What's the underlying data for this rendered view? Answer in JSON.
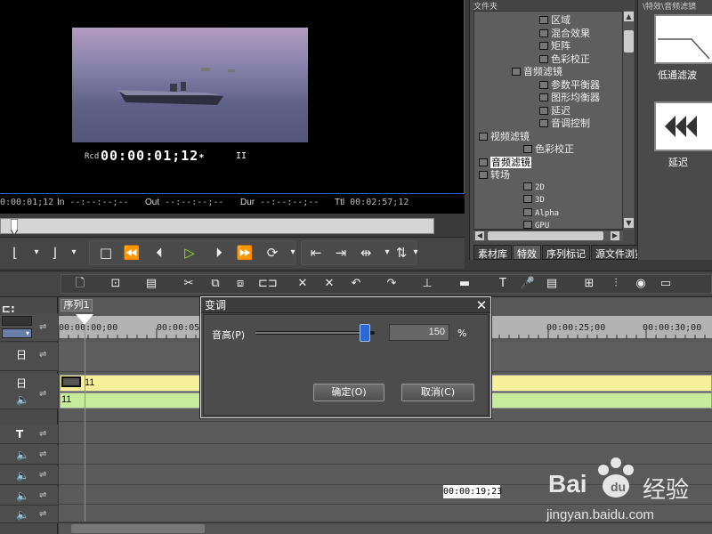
{
  "preview": {
    "rec_label": "Rcd",
    "timecode": "00:00:01;12",
    "tc_suffix": "*",
    "pause_symbol": "II",
    "current": "0:00:01;12",
    "in_label": "In",
    "in_value": "--:--:--;--",
    "out_label": "Out",
    "out_value": "--:--:--;--",
    "dur_label": "Dur",
    "dur_value": "--:--:--;--",
    "ttl_label": "Ttl",
    "ttl_value": "00:02:57;12"
  },
  "folder_panel": {
    "title": "文件夹",
    "tree": [
      {
        "label": "区域",
        "level": 3
      },
      {
        "label": "混合效果",
        "level": 3
      },
      {
        "label": "矩阵",
        "level": 3
      },
      {
        "label": "色彩校正",
        "level": 3
      },
      {
        "label": "音频滤镜",
        "level": 2
      },
      {
        "label": "参数平衡器",
        "level": 3
      },
      {
        "label": "图形均衡器",
        "level": 3
      },
      {
        "label": "延迟",
        "level": 3
      },
      {
        "label": "音调控制",
        "level": 3
      },
      {
        "label": "视频滤镜",
        "level": 1
      },
      {
        "label": "色彩校正",
        "level": 2
      },
      {
        "label": "音频滤镜",
        "level": 1,
        "selected": true
      },
      {
        "label": "转场",
        "level": 1
      },
      {
        "label": "2D",
        "level": 2
      },
      {
        "label": "3D",
        "level": 2
      },
      {
        "label": "Alpha",
        "level": 2
      },
      {
        "label": "GPU",
        "level": 2
      }
    ],
    "tabs": [
      "素材库",
      "特效",
      "序列标记",
      "源文件浏览"
    ],
    "active_tab": "特效"
  },
  "effect_panel": {
    "title": "\\特效\\音频滤镜",
    "items": [
      "低通滤波",
      "延迟"
    ]
  },
  "timeline": {
    "sequence_tab": "序列1",
    "ruler_labels": [
      "00:00:00;00",
      "00:00:05",
      "00:00:25;00",
      "00:00:30;00"
    ],
    "clip_video_label": "11",
    "clip_audio_label": "11",
    "timecode_popup": "00:00:19;23"
  },
  "dialog": {
    "title": "变调",
    "close_symbol": "✕",
    "pitch_label": "音高(P)",
    "pitch_value": "150",
    "pitch_unit": "%",
    "pitch_fraction": 0.92,
    "ok_label": "确定(O)",
    "cancel_label": "取消(C)"
  },
  "watermark": {
    "brand": "Bai",
    "brand_cn": "经验",
    "url": "jingyan.baidu.com"
  },
  "colors": {
    "accent_blue": "#2d69d6",
    "play_green": "#9be81f",
    "clip_video": "#f6f09a",
    "clip_audio": "#c7ec9b",
    "playhead": "#e7734e"
  }
}
